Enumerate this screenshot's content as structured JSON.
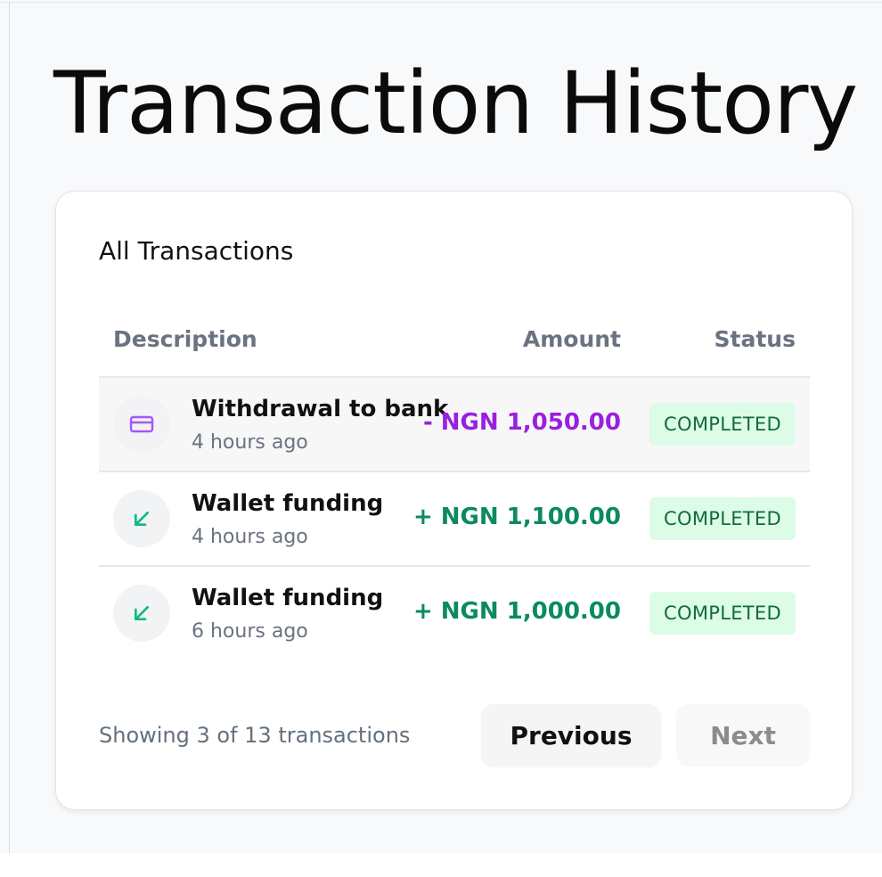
{
  "page": {
    "title": "Transaction History"
  },
  "card": {
    "title": "All Transactions"
  },
  "table": {
    "headers": {
      "description": "Description",
      "amount": "Amount",
      "status": "Status"
    },
    "rows": [
      {
        "icon": "credit-card-icon",
        "title": "Withdrawal to bank",
        "time": "4 hours ago",
        "amount": "- NGN 1,050.00",
        "status": "COMPLETED",
        "direction": "debit"
      },
      {
        "icon": "arrow-down-left-icon",
        "title": "Wallet funding",
        "time": "4 hours ago",
        "amount": "+ NGN 1,100.00",
        "status": "COMPLETED",
        "direction": "credit"
      },
      {
        "icon": "arrow-down-left-icon",
        "title": "Wallet funding",
        "time": "6 hours ago",
        "amount": "+ NGN 1,000.00",
        "status": "COMPLETED",
        "direction": "credit"
      }
    ]
  },
  "pagination": {
    "summary": "Showing 3 of 13 transactions",
    "previous_label": "Previous",
    "next_label": "Next"
  },
  "colors": {
    "debit": "#9a1fe0",
    "credit": "#0b8a60",
    "badge_bg": "#dcfce7",
    "badge_text": "#116b3d"
  }
}
